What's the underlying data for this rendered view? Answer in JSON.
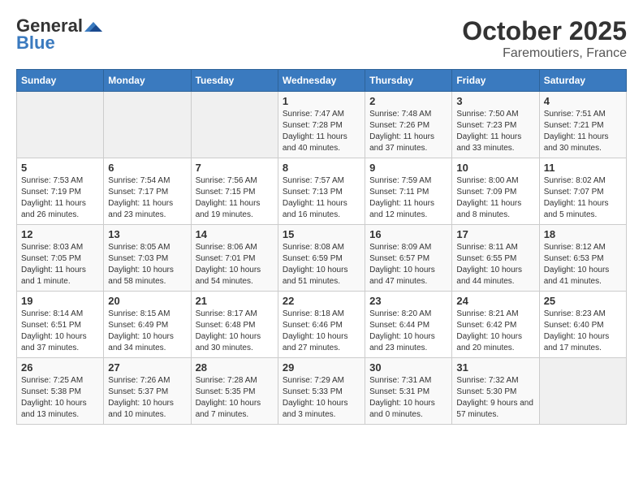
{
  "header": {
    "logo_line1": "General",
    "logo_line2": "Blue",
    "month": "October 2025",
    "location": "Faremoutiers, France"
  },
  "weekdays": [
    "Sunday",
    "Monday",
    "Tuesday",
    "Wednesday",
    "Thursday",
    "Friday",
    "Saturday"
  ],
  "weeks": [
    [
      {
        "day": "",
        "sunrise": "",
        "sunset": "",
        "daylight": ""
      },
      {
        "day": "",
        "sunrise": "",
        "sunset": "",
        "daylight": ""
      },
      {
        "day": "",
        "sunrise": "",
        "sunset": "",
        "daylight": ""
      },
      {
        "day": "1",
        "sunrise": "Sunrise: 7:47 AM",
        "sunset": "Sunset: 7:28 PM",
        "daylight": "Daylight: 11 hours and 40 minutes."
      },
      {
        "day": "2",
        "sunrise": "Sunrise: 7:48 AM",
        "sunset": "Sunset: 7:26 PM",
        "daylight": "Daylight: 11 hours and 37 minutes."
      },
      {
        "day": "3",
        "sunrise": "Sunrise: 7:50 AM",
        "sunset": "Sunset: 7:23 PM",
        "daylight": "Daylight: 11 hours and 33 minutes."
      },
      {
        "day": "4",
        "sunrise": "Sunrise: 7:51 AM",
        "sunset": "Sunset: 7:21 PM",
        "daylight": "Daylight: 11 hours and 30 minutes."
      }
    ],
    [
      {
        "day": "5",
        "sunrise": "Sunrise: 7:53 AM",
        "sunset": "Sunset: 7:19 PM",
        "daylight": "Daylight: 11 hours and 26 minutes."
      },
      {
        "day": "6",
        "sunrise": "Sunrise: 7:54 AM",
        "sunset": "Sunset: 7:17 PM",
        "daylight": "Daylight: 11 hours and 23 minutes."
      },
      {
        "day": "7",
        "sunrise": "Sunrise: 7:56 AM",
        "sunset": "Sunset: 7:15 PM",
        "daylight": "Daylight: 11 hours and 19 minutes."
      },
      {
        "day": "8",
        "sunrise": "Sunrise: 7:57 AM",
        "sunset": "Sunset: 7:13 PM",
        "daylight": "Daylight: 11 hours and 16 minutes."
      },
      {
        "day": "9",
        "sunrise": "Sunrise: 7:59 AM",
        "sunset": "Sunset: 7:11 PM",
        "daylight": "Daylight: 11 hours and 12 minutes."
      },
      {
        "day": "10",
        "sunrise": "Sunrise: 8:00 AM",
        "sunset": "Sunset: 7:09 PM",
        "daylight": "Daylight: 11 hours and 8 minutes."
      },
      {
        "day": "11",
        "sunrise": "Sunrise: 8:02 AM",
        "sunset": "Sunset: 7:07 PM",
        "daylight": "Daylight: 11 hours and 5 minutes."
      }
    ],
    [
      {
        "day": "12",
        "sunrise": "Sunrise: 8:03 AM",
        "sunset": "Sunset: 7:05 PM",
        "daylight": "Daylight: 11 hours and 1 minute."
      },
      {
        "day": "13",
        "sunrise": "Sunrise: 8:05 AM",
        "sunset": "Sunset: 7:03 PM",
        "daylight": "Daylight: 10 hours and 58 minutes."
      },
      {
        "day": "14",
        "sunrise": "Sunrise: 8:06 AM",
        "sunset": "Sunset: 7:01 PM",
        "daylight": "Daylight: 10 hours and 54 minutes."
      },
      {
        "day": "15",
        "sunrise": "Sunrise: 8:08 AM",
        "sunset": "Sunset: 6:59 PM",
        "daylight": "Daylight: 10 hours and 51 minutes."
      },
      {
        "day": "16",
        "sunrise": "Sunrise: 8:09 AM",
        "sunset": "Sunset: 6:57 PM",
        "daylight": "Daylight: 10 hours and 47 minutes."
      },
      {
        "day": "17",
        "sunrise": "Sunrise: 8:11 AM",
        "sunset": "Sunset: 6:55 PM",
        "daylight": "Daylight: 10 hours and 44 minutes."
      },
      {
        "day": "18",
        "sunrise": "Sunrise: 8:12 AM",
        "sunset": "Sunset: 6:53 PM",
        "daylight": "Daylight: 10 hours and 41 minutes."
      }
    ],
    [
      {
        "day": "19",
        "sunrise": "Sunrise: 8:14 AM",
        "sunset": "Sunset: 6:51 PM",
        "daylight": "Daylight: 10 hours and 37 minutes."
      },
      {
        "day": "20",
        "sunrise": "Sunrise: 8:15 AM",
        "sunset": "Sunset: 6:49 PM",
        "daylight": "Daylight: 10 hours and 34 minutes."
      },
      {
        "day": "21",
        "sunrise": "Sunrise: 8:17 AM",
        "sunset": "Sunset: 6:48 PM",
        "daylight": "Daylight: 10 hours and 30 minutes."
      },
      {
        "day": "22",
        "sunrise": "Sunrise: 8:18 AM",
        "sunset": "Sunset: 6:46 PM",
        "daylight": "Daylight: 10 hours and 27 minutes."
      },
      {
        "day": "23",
        "sunrise": "Sunrise: 8:20 AM",
        "sunset": "Sunset: 6:44 PM",
        "daylight": "Daylight: 10 hours and 23 minutes."
      },
      {
        "day": "24",
        "sunrise": "Sunrise: 8:21 AM",
        "sunset": "Sunset: 6:42 PM",
        "daylight": "Daylight: 10 hours and 20 minutes."
      },
      {
        "day": "25",
        "sunrise": "Sunrise: 8:23 AM",
        "sunset": "Sunset: 6:40 PM",
        "daylight": "Daylight: 10 hours and 17 minutes."
      }
    ],
    [
      {
        "day": "26",
        "sunrise": "Sunrise: 7:25 AM",
        "sunset": "Sunset: 5:38 PM",
        "daylight": "Daylight: 10 hours and 13 minutes."
      },
      {
        "day": "27",
        "sunrise": "Sunrise: 7:26 AM",
        "sunset": "Sunset: 5:37 PM",
        "daylight": "Daylight: 10 hours and 10 minutes."
      },
      {
        "day": "28",
        "sunrise": "Sunrise: 7:28 AM",
        "sunset": "Sunset: 5:35 PM",
        "daylight": "Daylight: 10 hours and 7 minutes."
      },
      {
        "day": "29",
        "sunrise": "Sunrise: 7:29 AM",
        "sunset": "Sunset: 5:33 PM",
        "daylight": "Daylight: 10 hours and 3 minutes."
      },
      {
        "day": "30",
        "sunrise": "Sunrise: 7:31 AM",
        "sunset": "Sunset: 5:31 PM",
        "daylight": "Daylight: 10 hours and 0 minutes."
      },
      {
        "day": "31",
        "sunrise": "Sunrise: 7:32 AM",
        "sunset": "Sunset: 5:30 PM",
        "daylight": "Daylight: 9 hours and 57 minutes."
      },
      {
        "day": "",
        "sunrise": "",
        "sunset": "",
        "daylight": ""
      }
    ]
  ]
}
